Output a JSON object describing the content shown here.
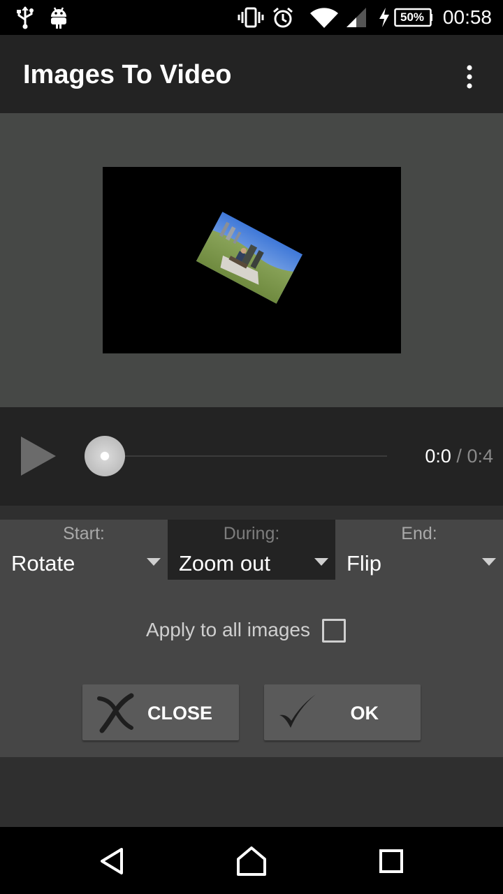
{
  "status_bar": {
    "battery": "50%",
    "clock": "00:58"
  },
  "app_bar": {
    "title": "Images To Video"
  },
  "player": {
    "current_time": "0:0",
    "separator": "/",
    "total_time": "0:4",
    "progress": 0
  },
  "transitions": {
    "start": {
      "label": "Start:",
      "value": "Rotate"
    },
    "during": {
      "label": "During:",
      "value": "Zoom out"
    },
    "end": {
      "label": "End:",
      "value": "Flip"
    }
  },
  "apply_all": {
    "label": "Apply to all images",
    "checked": false
  },
  "buttons": {
    "close": "CLOSE",
    "ok": "OK"
  },
  "icons": {
    "status_left": [
      "usb-icon",
      "android-debug-icon"
    ],
    "status_right": [
      "vibrate-icon",
      "alarm-icon",
      "wifi-icon",
      "signal-icon",
      "charging-icon",
      "battery-icon"
    ],
    "app_bar": "overflow-menu-icon",
    "player": "play-icon",
    "dialog": [
      "close-x-icon",
      "checkmark-icon"
    ],
    "nav": [
      "back-icon",
      "home-icon",
      "recents-icon"
    ]
  }
}
